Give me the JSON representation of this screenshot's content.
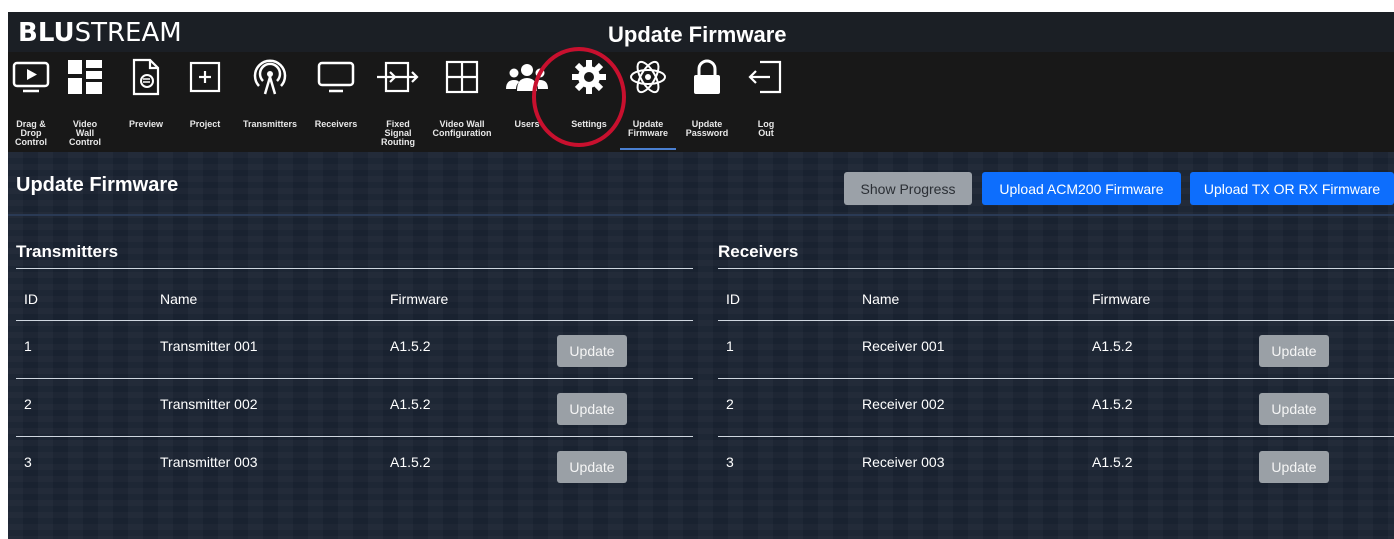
{
  "header": {
    "logo_bold": "BLU",
    "logo_light": "STREAM",
    "title": "Update Firmware"
  },
  "toolbar": [
    {
      "name": "drag-drop-control",
      "icon": "monitor-play-icon",
      "label": "Drag & Drop\nControl"
    },
    {
      "name": "video-wall-control",
      "icon": "video-wall-grid-icon",
      "label": "Video Wall\nControl"
    },
    {
      "name": "preview",
      "icon": "document-preview-icon",
      "label": "Preview"
    },
    {
      "name": "project",
      "icon": "plus-square-icon",
      "label": "Project"
    },
    {
      "name": "transmitters",
      "icon": "broadcast-tower-icon",
      "label": "Transmitters"
    },
    {
      "name": "receivers",
      "icon": "display-icon",
      "label": "Receivers"
    },
    {
      "name": "fixed-signal-routing",
      "icon": "routing-arrows-icon",
      "label": "Fixed Signal\nRouting"
    },
    {
      "name": "video-wall-configuration",
      "icon": "grid-four-icon",
      "label": "Video Wall\nConfiguration"
    },
    {
      "name": "users",
      "icon": "users-group-icon",
      "label": "Users"
    },
    {
      "name": "settings",
      "icon": "gear-icon",
      "label": "Settings"
    },
    {
      "name": "update-firmware",
      "icon": "atom-icon",
      "label": "Update\nFirmware",
      "active": true
    },
    {
      "name": "update-password",
      "icon": "lock-icon",
      "label": "Update\nPassword"
    },
    {
      "name": "log-out",
      "icon": "logout-icon",
      "label": "Log Out"
    }
  ],
  "page": {
    "title": "Update Firmware",
    "show_progress": "Show Progress",
    "upload_acm": "Upload ACM200 Firmware",
    "upload_txrx": "Upload TX OR RX Firmware"
  },
  "columns": {
    "id": "ID",
    "name": "Name",
    "firmware": "Firmware"
  },
  "update_label": "Update",
  "transmitters": {
    "title": "Transmitters",
    "rows": [
      {
        "id": "1",
        "name": "Transmitter 001",
        "firmware": "A1.5.2"
      },
      {
        "id": "2",
        "name": "Transmitter 002",
        "firmware": "A1.5.2"
      },
      {
        "id": "3",
        "name": "Transmitter 003",
        "firmware": "A1.5.2"
      }
    ]
  },
  "receivers": {
    "title": "Receivers",
    "rows": [
      {
        "id": "1",
        "name": "Receiver 001",
        "firmware": "A1.5.2"
      },
      {
        "id": "2",
        "name": "Receiver 002",
        "firmware": "A1.5.2"
      },
      {
        "id": "3",
        "name": "Receiver 003",
        "firmware": "A1.5.2"
      }
    ]
  },
  "colors": {
    "accent": "#0d6efd",
    "highlight": "#c8102e",
    "background": "#192230"
  }
}
